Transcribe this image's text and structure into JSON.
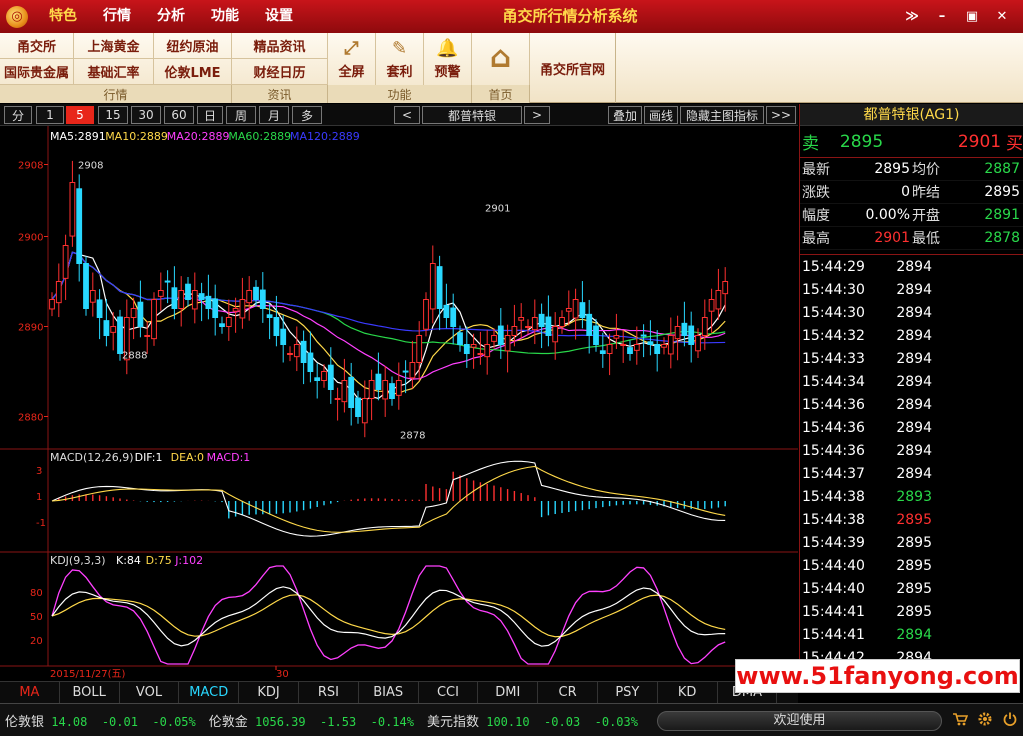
{
  "titlebar": {
    "logo_glyph": "◎",
    "menu": [
      "特色",
      "行情",
      "分析",
      "功能",
      "设置"
    ],
    "title": "甬交所行情分析系统",
    "controls": [
      "≫",
      "–",
      "▣",
      "✕"
    ]
  },
  "toolbar": {
    "cells": [
      "甬交所",
      "上海黄金",
      "纽约原油",
      "精品资讯",
      "国际贵金属",
      "基础汇率",
      "伦敦LME",
      "财经日历"
    ],
    "groups": [
      "行情",
      "资讯",
      "功能",
      "首页"
    ],
    "big": [
      {
        "label": "全屏",
        "icon": "⤢"
      },
      {
        "label": "套利",
        "icon": "✎"
      },
      {
        "label": "预警",
        "icon": "🔔"
      },
      {
        "label": "",
        "icon": "⌂"
      },
      {
        "label": "甬交所官网",
        "icon": ""
      }
    ]
  },
  "chart_controls": {
    "periods": [
      "分",
      "1",
      "5",
      "15",
      "30",
      "60",
      "日",
      "周",
      "月",
      "多"
    ],
    "active_period": "5",
    "prev": "<",
    "symbol": "都普特银",
    "next": ">",
    "tools": [
      "叠加",
      "画线",
      "隐藏主图指标",
      ">>"
    ]
  },
  "chart_data": [
    {
      "type": "candlestick",
      "title": "",
      "legend": [
        {
          "text": "MA5:2891",
          "color": "#ffffff"
        },
        {
          "text": "MA10:2889",
          "color": "#ffd94a"
        },
        {
          "text": "MA20:2889",
          "color": "#ff40ff"
        },
        {
          "text": "MA60:2889",
          "color": "#29d84a"
        },
        {
          "text": "MA120:2889",
          "color": "#3a3aff"
        }
      ],
      "yticks": [
        2908,
        2900,
        2890,
        2880
      ],
      "ylim": [
        2876.5,
        2910.5
      ],
      "annotations": [
        {
          "text": "2908",
          "value": 2908
        },
        {
          "text": "2901",
          "value": 2901
        },
        {
          "text": "2888",
          "value": 2888
        },
        {
          "text": "2878",
          "value": 2878
        }
      ],
      "x_labels": [
        "2015/11/27(五)",
        "30"
      ]
    },
    {
      "type": "bar",
      "title": "MACD(12,26,9)",
      "legend": [
        {
          "text": "DIF:1",
          "color": "#ffffff"
        },
        {
          "text": "DEA:0",
          "color": "#ffd94a"
        },
        {
          "text": "MACD:1",
          "color": "#ff40ff"
        }
      ],
      "yticks": [
        "3",
        "1",
        "-1"
      ]
    },
    {
      "type": "line",
      "title": "KDJ(9,3,3)",
      "legend": [
        {
          "text": "K:84",
          "color": "#ffffff"
        },
        {
          "text": "D:75",
          "color": "#ffd94a"
        },
        {
          "text": "J:102",
          "color": "#ff40ff"
        }
      ],
      "yticks": [
        "80",
        "50",
        "20"
      ]
    }
  ],
  "quote": {
    "title": "都普特银(AG1)",
    "sell_label": "卖",
    "sell": "2895",
    "buy": "2901",
    "buy_label": "买",
    "rows": [
      {
        "l1": "最新",
        "v1": "2895",
        "l2": "均价",
        "v2": "2887",
        "c1": "w",
        "c2": "g"
      },
      {
        "l1": "涨跌",
        "v1": "0",
        "l2": "昨结",
        "v2": "2895",
        "c1": "w",
        "c2": "w"
      },
      {
        "l1": "幅度",
        "v1": "0.00%",
        "l2": "开盘",
        "v2": "2891",
        "c1": "w",
        "c2": "g"
      },
      {
        "l1": "最高",
        "v1": "2901",
        "l2": "最低",
        "v2": "2878",
        "c1": "r",
        "c2": "g"
      }
    ],
    "ticks": [
      {
        "t": "15:44:29",
        "p": "2894",
        "c": "w"
      },
      {
        "t": "15:44:30",
        "p": "2894",
        "c": "w"
      },
      {
        "t": "15:44:30",
        "p": "2894",
        "c": "w"
      },
      {
        "t": "15:44:32",
        "p": "2894",
        "c": "w"
      },
      {
        "t": "15:44:33",
        "p": "2894",
        "c": "w"
      },
      {
        "t": "15:44:34",
        "p": "2894",
        "c": "w"
      },
      {
        "t": "15:44:36",
        "p": "2894",
        "c": "w"
      },
      {
        "t": "15:44:36",
        "p": "2894",
        "c": "w"
      },
      {
        "t": "15:44:36",
        "p": "2894",
        "c": "w"
      },
      {
        "t": "15:44:37",
        "p": "2894",
        "c": "w"
      },
      {
        "t": "15:44:38",
        "p": "2893",
        "c": "g"
      },
      {
        "t": "15:44:38",
        "p": "2895",
        "c": "r"
      },
      {
        "t": "15:44:39",
        "p": "2895",
        "c": "w"
      },
      {
        "t": "15:44:40",
        "p": "2895",
        "c": "w"
      },
      {
        "t": "15:44:40",
        "p": "2895",
        "c": "w"
      },
      {
        "t": "15:44:41",
        "p": "2895",
        "c": "w"
      },
      {
        "t": "15:44:41",
        "p": "2894",
        "c": "g"
      },
      {
        "t": "15:44:42",
        "p": "2894",
        "c": "w"
      }
    ]
  },
  "indicator_tabs": [
    "MA",
    "BOLL",
    "VOL",
    "MACD",
    "KDJ",
    "RSI",
    "BIAS",
    "CCI",
    "DMI",
    "CR",
    "PSY",
    "KD",
    "DMA"
  ],
  "status": {
    "items": [
      {
        "name": "伦敦银",
        "v": "14.08",
        "c": "-0.01",
        "p": "-0.05%"
      },
      {
        "name": "伦敦金",
        "v": "1056.39",
        "c": "-1.53",
        "p": "-0.14%"
      },
      {
        "name": "美元指数",
        "v": "100.10",
        "c": "-0.03",
        "p": "-0.03%"
      }
    ],
    "welcome": "欢迎使用",
    "icons": [
      "cart-icon",
      "gear-icon",
      "power-icon"
    ]
  },
  "watermark": "www.51fanyong.com"
}
